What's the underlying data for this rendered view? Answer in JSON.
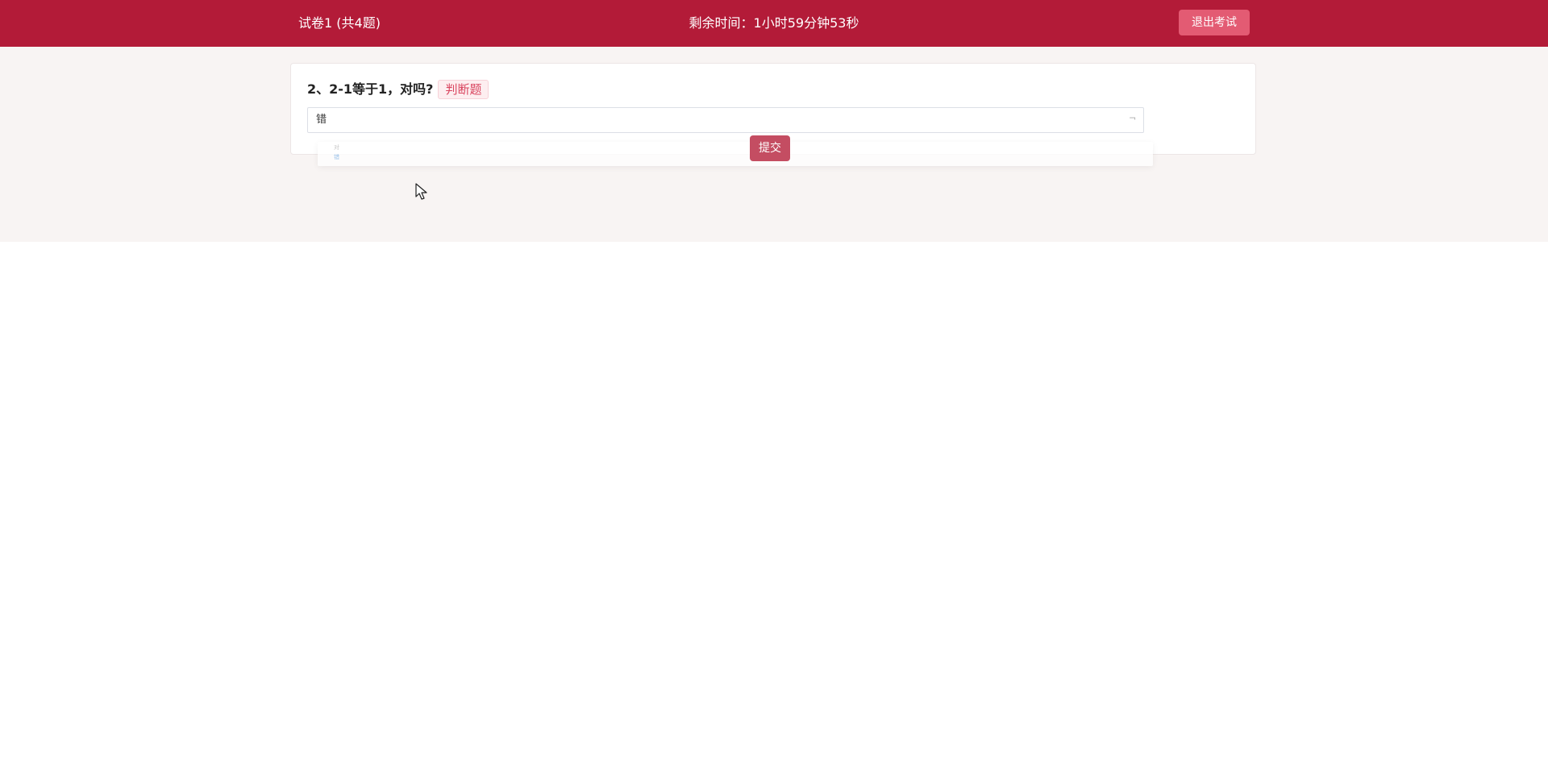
{
  "header": {
    "title": "试卷1 (共4题)",
    "timer": "剩余时间：1小时59分钟53秒",
    "exit_label": "退出考试"
  },
  "question": {
    "text": "2、2-1等于1，对吗?",
    "type_tag": "判断题",
    "selected_value": "错",
    "options": [
      "对",
      "错"
    ]
  },
  "actions": {
    "submit_label": "提交"
  },
  "colors": {
    "header_bg": "#b31b38",
    "exit_button": "#e35b73",
    "submit_button": "#c44d62",
    "page_bg": "#f8f4f3",
    "tag_text": "#d9455f"
  }
}
